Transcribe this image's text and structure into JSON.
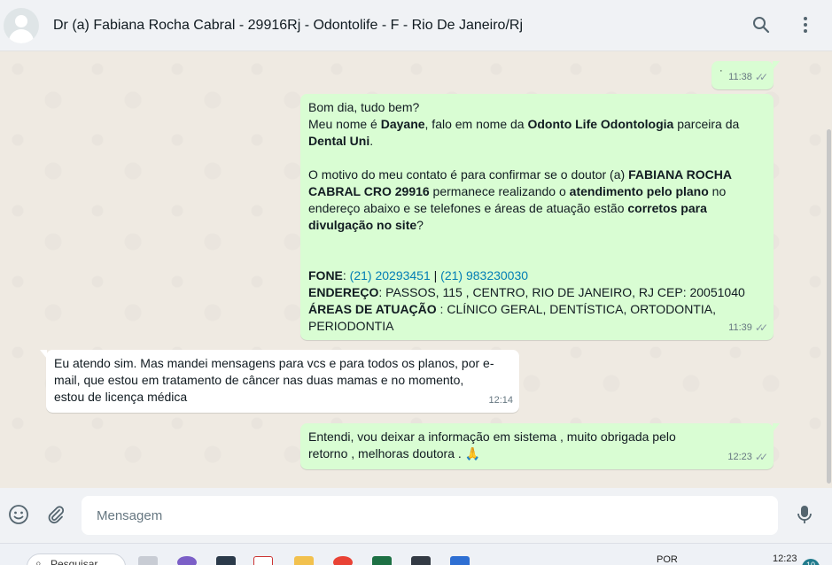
{
  "header": {
    "title": "Dr (a) Fabiana Rocha Cabral - 29916Rj - Odontolife - F - Rio De Janeiro/Rj",
    "icons": [
      "search-icon",
      "menu-dots-icon"
    ]
  },
  "messages": [
    {
      "direction": "out",
      "text": "·",
      "time": "11:38",
      "status": "read"
    },
    {
      "direction": "out",
      "line1": "Bom dia, tudo bem?",
      "p2_pre": "Meu nome é ",
      "p2_name": "Dayane",
      "p2_mid": ", falo em nome da ",
      "p2_company": "Odonto Life Odontologia",
      "p2_post": " parceira da ",
      "p2_partner": "Dental Uni",
      "p2_end": ".",
      "p3_pre": "O motivo do meu contato é para confirmar se o doutor (a) ",
      "p3_doctor": "FABIANA ROCHA CABRAL  CRO 29916",
      "p3_mid": " permanece realizando o ",
      "p3_service": "atendimento pelo plano",
      "p3_mid2": " no endereço abaixo e se telefones e áreas de atuação estão ",
      "p3_correct": "corretos para divulgação no site",
      "p3_end": "?",
      "fone_label": "FONE",
      "fone_sep1": ": ",
      "phone1": "(21) 20293451",
      "fone_sep2": " | ",
      "phone2": "(21) 983230030",
      "endereco_label": "ENDEREÇO",
      "endereco_value": ": PASSOS, 115 , CENTRO, RIO DE JANEIRO, RJ CEP: 20051040",
      "areas_label": "ÁREAS DE ATUAÇÃO",
      "areas_value": " : CLÍNICO GERAL, DENTÍSTICA, ORTODONTIA, PERIODONTIA",
      "time": "11:39",
      "status": "read"
    },
    {
      "direction": "in",
      "text": "Eu atendo sim. Mas mandei mensagens para vcs e para todos os planos, por e-mail, que estou em tratamento de câncer nas duas mamas e no momento, estou de licença médica",
      "time": "12:14"
    },
    {
      "direction": "out",
      "text": "Entendi, vou deixar a informação em sistema , muito obrigada pelo retorno , melhoras doutora . 🙏",
      "time": "12:23",
      "status": "read"
    }
  ],
  "composer": {
    "placeholder": "Mensagem",
    "icons": [
      "emoji-icon",
      "attach-icon",
      "microphone-icon"
    ]
  },
  "taskbar": {
    "search_label": "Pesquisar",
    "lang": "POR",
    "time": "12:23",
    "badge": "10"
  },
  "colors": {
    "outgoing_bubble": "#d9fdd3",
    "incoming_bubble": "#ffffff",
    "chat_background": "#efeae2",
    "header_background": "#f0f2f5",
    "link": "#027eb5"
  }
}
